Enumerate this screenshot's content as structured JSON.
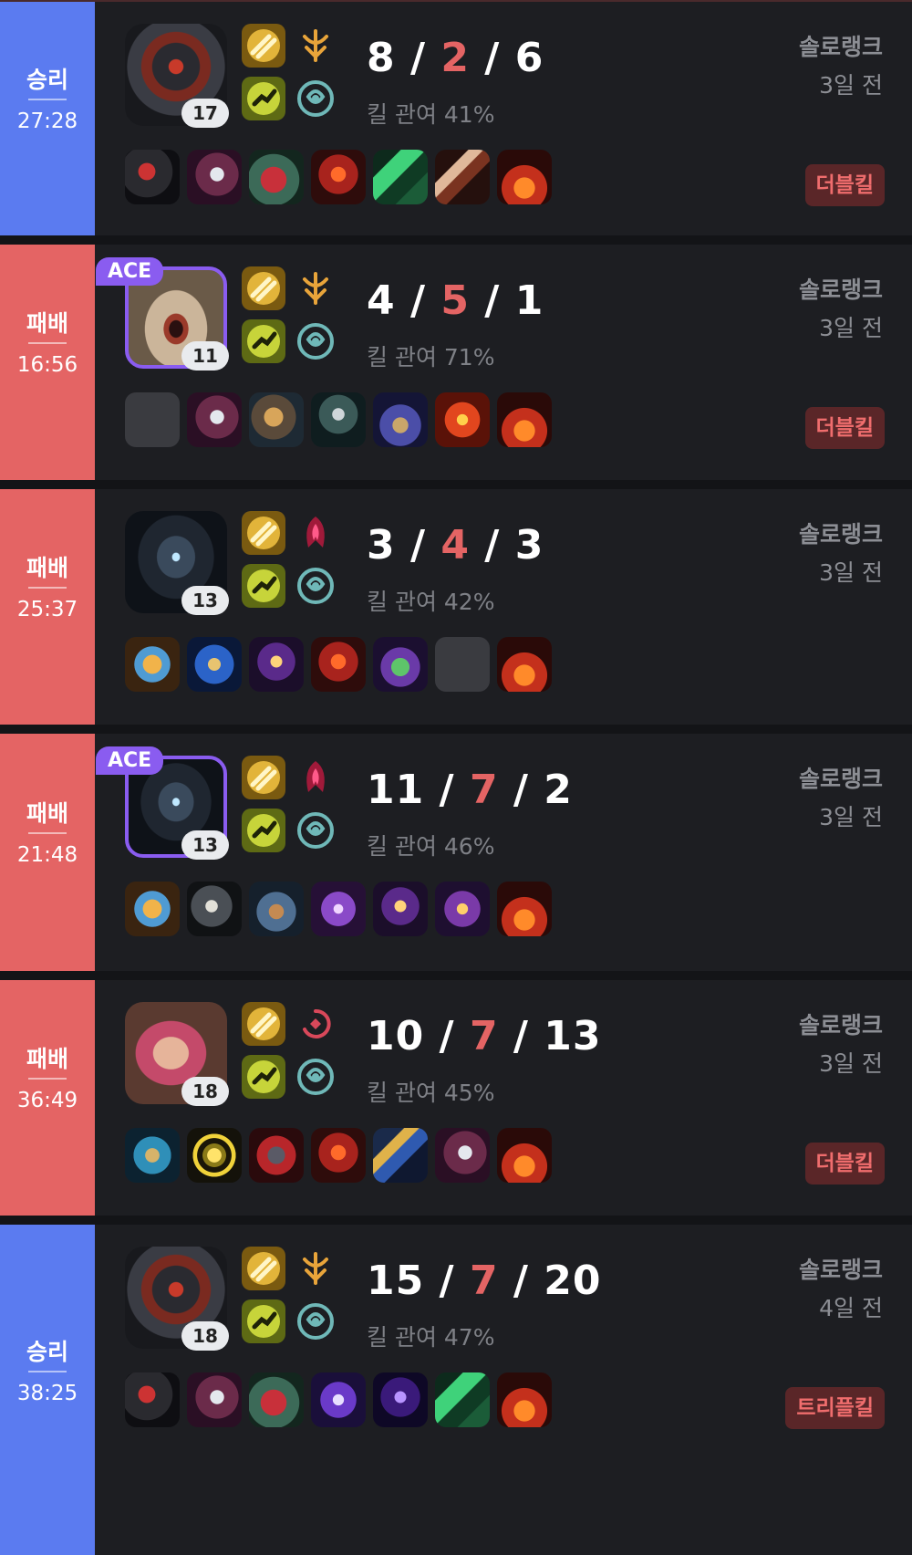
{
  "matches": [
    {
      "result": "승리",
      "result_type": "win",
      "duration": "27:28",
      "champion": "zed",
      "level": "17",
      "ace": false,
      "spells": [
        "flash",
        "ignite"
      ],
      "runes": [
        "electrocute",
        "domination"
      ],
      "kda": {
        "k": "8",
        "d": "2",
        "a": "6"
      },
      "kill_participation": "킬 관여 41%",
      "queue": "솔로랭크",
      "ago": "3일 전",
      "multikill": "더블킬",
      "items": [
        "axe-dark",
        "blade-purple",
        "boots-red",
        "hydra-red",
        "sword-green",
        "blade-serrated",
        "trinket-red"
      ]
    },
    {
      "result": "패배",
      "result_type": "loss",
      "duration": "16:56",
      "champion": "pyke",
      "level": "11",
      "ace": true,
      "ace_label": "ACE",
      "spells": [
        "flash",
        "ignite"
      ],
      "runes": [
        "electrocute",
        "domination"
      ],
      "kda": {
        "k": "4",
        "d": "5",
        "a": "1"
      },
      "kill_participation": "킬 관여 71%",
      "queue": "솔로랭크",
      "ago": "3일 전",
      "multikill": "더블킬",
      "items": [
        "empty",
        "blade-purple",
        "hammer-gold",
        "pickaxe",
        "boots-purple",
        "orb-red",
        "trinket-red"
      ]
    },
    {
      "result": "패배",
      "result_type": "loss",
      "duration": "25:37",
      "champion": "aphelios",
      "level": "13",
      "ace": false,
      "spells": [
        "flash",
        "ignite"
      ],
      "runes": [
        "dark-harvest",
        "domination"
      ],
      "kda": {
        "k": "3",
        "d": "4",
        "a": "3"
      },
      "kill_participation": "킬 관여 42%",
      "queue": "솔로랭크",
      "ago": "3일 전",
      "multikill": "",
      "items": [
        "gauntlet-gold",
        "bow-blue",
        "mask-purple",
        "hydra-red",
        "boots-green",
        "empty",
        "trinket-red"
      ]
    },
    {
      "result": "패배",
      "result_type": "loss",
      "duration": "21:48",
      "champion": "aphelios",
      "level": "13",
      "ace": true,
      "ace_label": "ACE",
      "spells": [
        "flash",
        "ignite"
      ],
      "runes": [
        "dark-harvest",
        "domination"
      ],
      "kda": {
        "k": "11",
        "d": "7",
        "a": "2"
      },
      "kill_participation": "킬 관여 46%",
      "queue": "솔로랭크",
      "ago": "3일 전",
      "multikill": "",
      "items": [
        "gauntlet-gold",
        "gun-dark",
        "boots-steel",
        "orb-purple",
        "mask-purple",
        "eye-purple",
        "trinket-red"
      ]
    },
    {
      "result": "패배",
      "result_type": "loss",
      "duration": "36:49",
      "champion": "vi",
      "level": "18",
      "ace": false,
      "spells": [
        "flash",
        "ignite"
      ],
      "runes": [
        "swift",
        "domination"
      ],
      "kda": {
        "k": "10",
        "d": "7",
        "a": "13"
      },
      "kill_participation": "킬 관여 45%",
      "queue": "솔로랭크",
      "ago": "3일 전",
      "multikill": "더블킬",
      "items": [
        "cannon-blue",
        "shield-yellow",
        "armor-red",
        "hydra-red",
        "spear-gold",
        "blade-purple",
        "trinket-red"
      ]
    },
    {
      "result": "승리",
      "result_type": "win",
      "duration": "38:25",
      "champion": "zed",
      "level": "18",
      "ace": false,
      "spells": [
        "flash",
        "ignite"
      ],
      "runes": [
        "electrocute",
        "domination"
      ],
      "kda": {
        "k": "15",
        "d": "7",
        "a": "20"
      },
      "kill_participation": "킬 관여 47%",
      "queue": "솔로랭크",
      "ago": "4일 전",
      "multikill": "트리플킬",
      "items": [
        "axe-dark",
        "blade-purple",
        "boots-red",
        "blade-violet",
        "cloak-purple",
        "sword-green",
        "trinket-red"
      ]
    }
  ],
  "colors": {
    "win": "#5b7bf0",
    "loss": "#e46464",
    "death": "#e46464",
    "ace": "#8a5cf0",
    "card": "#1d1e22"
  }
}
